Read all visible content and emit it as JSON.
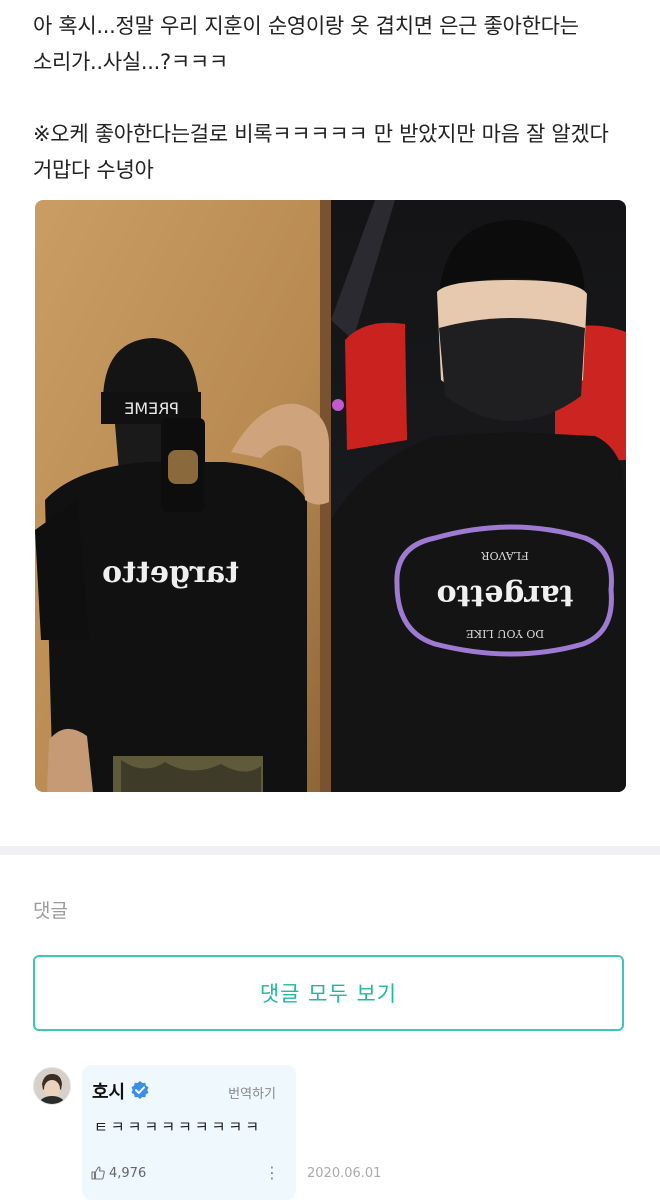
{
  "post": {
    "line1": "아 혹시...정말 우리 지훈이 순영이랑 옷 겹치면 은근 좋아한다는",
    "line2": "소리가..사실...?ㅋㅋㅋ",
    "line3": "※오케 좋아한다는걸로 비록ㅋㅋㅋㅋㅋ 만 받았지만 마음 잘 알겠다",
    "line4": "거맙다 수녕아"
  },
  "photo": {
    "left_shirt_text": "targetto",
    "right_shirt_text": "targetto",
    "right_badge_top": "DO YOU LIKE",
    "right_badge_bottom": "FLAVOR",
    "beanie_text": "PREME"
  },
  "comments": {
    "heading": "댓글",
    "view_all_label": "댓글 모두 보기"
  },
  "comment": {
    "author": "호시",
    "translate_label": "번역하기",
    "text": "ㅌㅋㅋㅋㅋㅋㅋㅋㅋㅋ",
    "likes": "4,976",
    "more": "⋮",
    "date": "2020.06.01"
  },
  "colors": {
    "accent": "#1fb9a0",
    "button_border": "#3ec8b1",
    "bubble_bg": "#eef8fd",
    "verified": "#3a8ee8"
  }
}
